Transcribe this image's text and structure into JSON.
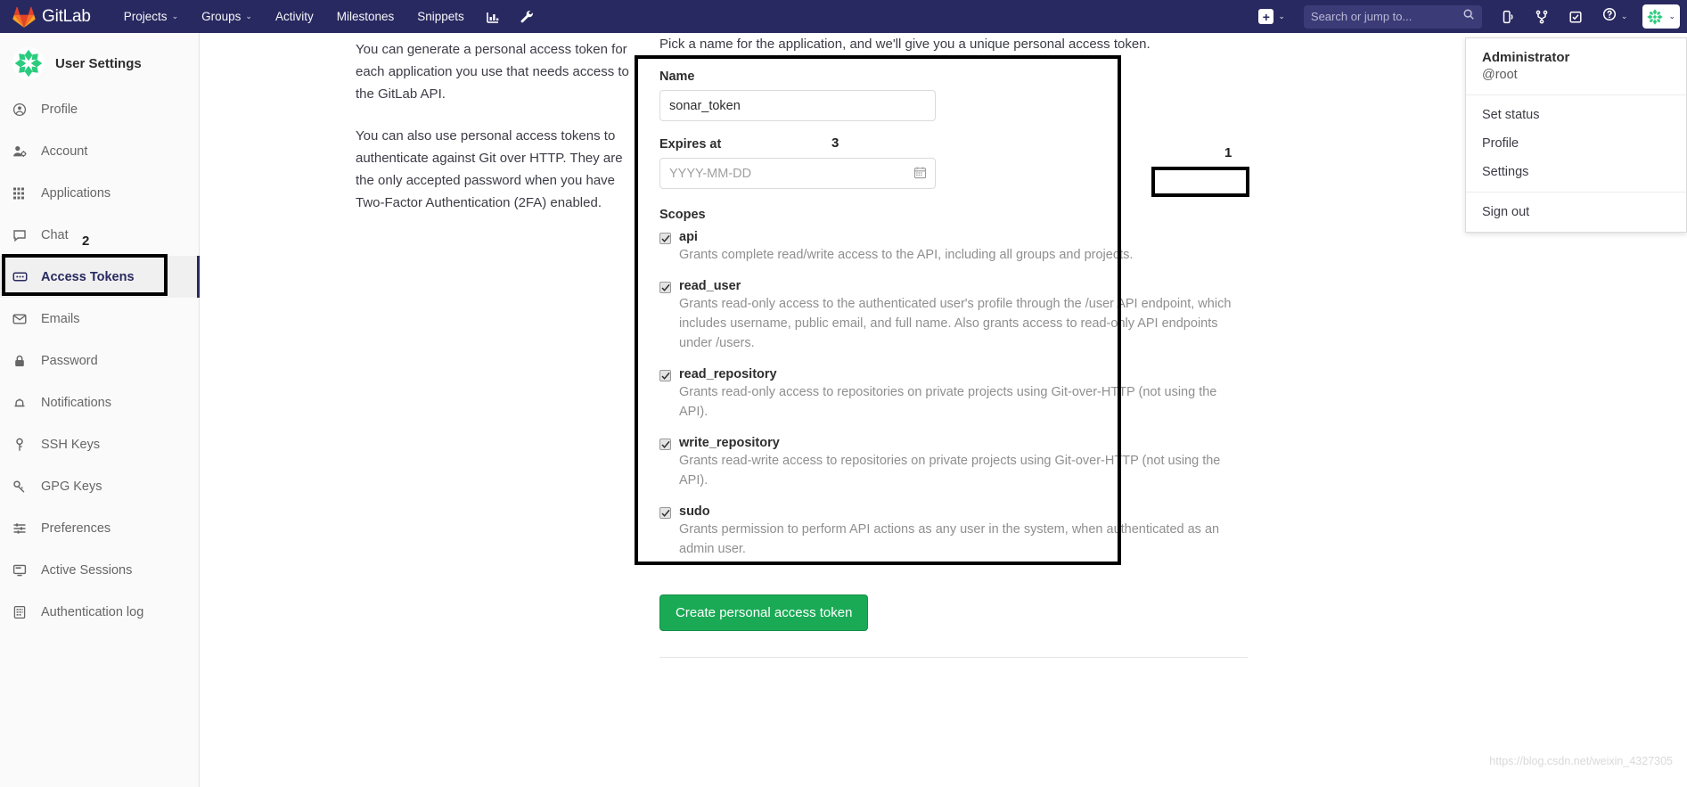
{
  "navbar": {
    "brand": "GitLab",
    "brand_icon": "gitlab-tanuki-icon",
    "links": [
      {
        "label": "Projects",
        "caret": "⌄"
      },
      {
        "label": "Groups",
        "caret": "⌄"
      },
      {
        "label": "Activity",
        "caret": ""
      },
      {
        "label": "Milestones",
        "caret": ""
      },
      {
        "label": "Snippets",
        "caret": ""
      }
    ],
    "icon_buttons": [
      {
        "name": "analytics-icon"
      },
      {
        "name": "wrench-icon"
      }
    ],
    "plus_label": "+",
    "plus_caret": "⌄",
    "search": {
      "placeholder": "Search or jump to...",
      "value": ""
    },
    "right_icons": [
      {
        "name": "issues-icon"
      },
      {
        "name": "merge-requests-icon"
      },
      {
        "name": "todos-icon"
      },
      {
        "name": "help-icon"
      }
    ],
    "help_caret": "⌄",
    "avatar_caret": "⌄"
  },
  "sidebar": {
    "title": "User Settings",
    "items": [
      {
        "label": "Profile",
        "icon": "user-circle-icon",
        "active": false
      },
      {
        "label": "Account",
        "icon": "account-icon",
        "active": false
      },
      {
        "label": "Applications",
        "icon": "applications-grid-icon",
        "active": false
      },
      {
        "label": "Chat",
        "icon": "chat-bubble-icon",
        "active": false
      },
      {
        "label": "Access Tokens",
        "icon": "token-icon",
        "active": true
      },
      {
        "label": "Emails",
        "icon": "envelope-icon",
        "active": false
      },
      {
        "label": "Password",
        "icon": "lock-icon",
        "active": false
      },
      {
        "label": "Notifications",
        "icon": "bell-icon",
        "active": false
      },
      {
        "label": "SSH Keys",
        "icon": "key-icon",
        "active": false
      },
      {
        "label": "GPG Keys",
        "icon": "key-icon",
        "active": false
      },
      {
        "label": "Preferences",
        "icon": "sliders-icon",
        "active": false
      },
      {
        "label": "Active Sessions",
        "icon": "monitor-icon",
        "active": false
      },
      {
        "label": "Authentication log",
        "icon": "log-icon",
        "active": false
      }
    ]
  },
  "main": {
    "intro_paragraph_1": "You can generate a personal access token for each application you use that needs access to the GitLab API.",
    "intro_paragraph_2": "You can also use personal access tokens to authenticate against Git over HTTP. They are the only accepted password when you have Two-Factor Authentication (2FA) enabled.",
    "lead": "Pick a name for the application, and we'll give you a unique personal access token.",
    "name_label": "Name",
    "name_value": "sonar_token",
    "expires_label": "Expires at",
    "expires_placeholder": "YYYY-MM-DD",
    "expires_value": "",
    "calendar_icon": "calendar-icon",
    "scopes_label": "Scopes",
    "scopes": [
      {
        "name": "api",
        "checked": true,
        "description": "Grants complete read/write access to the API, including all groups and projects."
      },
      {
        "name": "read_user",
        "checked": true,
        "description": "Grants read-only access to the authenticated user's profile through the /user API endpoint, which includes username, public email, and full name. Also grants access to read-only API endpoints under /users."
      },
      {
        "name": "read_repository",
        "checked": true,
        "description": "Grants read-only access to repositories on private projects using Git-over-HTTP (not using the API)."
      },
      {
        "name": "write_repository",
        "checked": true,
        "description": "Grants read-write access to repositories on private projects using Git-over-HTTP (not using the API)."
      },
      {
        "name": "sudo",
        "checked": true,
        "description": "Grants permission to perform API actions as any user in the system, when authenticated as an admin user."
      }
    ],
    "create_button": "Create personal access token"
  },
  "user_menu": {
    "name": "Administrator",
    "handle": "@root",
    "items": [
      {
        "label": "Set status"
      },
      {
        "label": "Profile"
      },
      {
        "label": "Settings"
      }
    ],
    "sign_out": "Sign out"
  },
  "annotations": [
    {
      "number": "1"
    },
    {
      "number": "2"
    },
    {
      "number": "3"
    }
  ],
  "watermark": "https://blog.csdn.net/weixin_4327305",
  "colors": {
    "navbar_bg": "#292961",
    "accent": "#292961",
    "primary_green": "#1aaa55",
    "sidebar_bg": "#fafafa",
    "annotation": "#000000"
  }
}
